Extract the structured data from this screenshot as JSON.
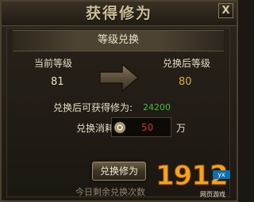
{
  "window": {
    "title": "获得修为",
    "close_label": "X"
  },
  "section": {
    "title": "等级兑换"
  },
  "exchange": {
    "current_level_label": "当前等级",
    "current_level_value": "81",
    "after_level_label": "兑换后等级",
    "after_level_value": "80",
    "obtainable_label": "兑换后可获得修为:",
    "obtainable_value": "24200",
    "cost_label": "兑换消耗:",
    "cost_value": "50",
    "cost_unit": "万",
    "cost_icon": "coin-icon"
  },
  "actions": {
    "exchange_button_label": "兑换修为"
  },
  "footer": {
    "remaining_text": "今日剩余兑换次数"
  },
  "watermark": {
    "digits": "1912",
    "badge": "yx",
    "subtitle": "网页游戏"
  },
  "colors": {
    "background": "#1b1712",
    "gold_value": "#d8b23a",
    "green_value": "#3fbf3a",
    "red_value": "#d43030"
  }
}
